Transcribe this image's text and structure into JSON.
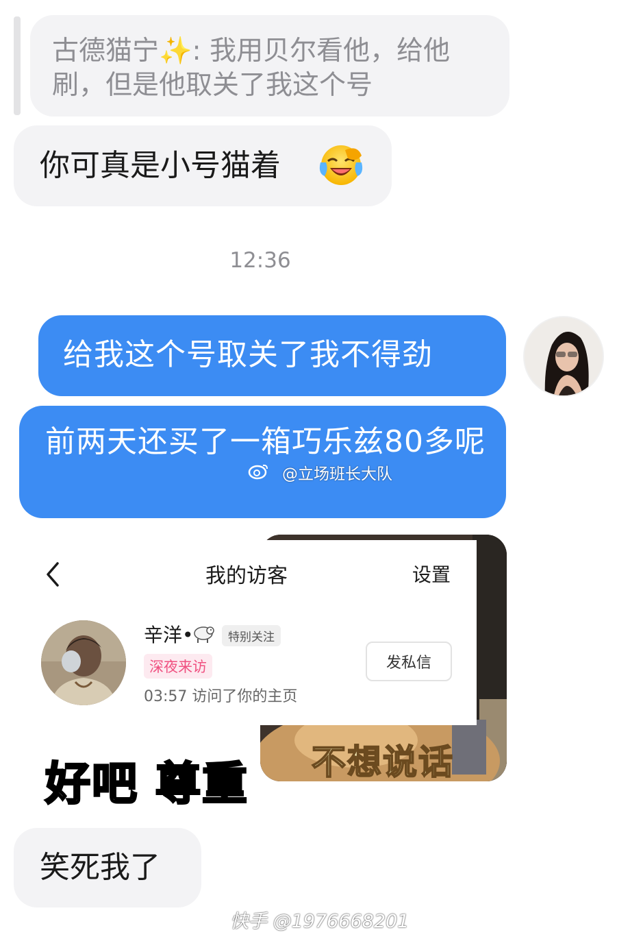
{
  "quoted_message": {
    "text": "古德猫宁✨: 我用贝尔看他，给他刷，但是他取关了我这个号"
  },
  "messages": [
    {
      "side": "left",
      "text": "你可真是小号猫着"
    },
    {
      "side": "right",
      "text": "给我这个号取关了我不得劲"
    },
    {
      "side": "right",
      "text": "前两天还买了一箱巧乐兹80多呢"
    },
    {
      "side": "left",
      "text": "笑死我了"
    }
  ],
  "timestamp": "12:36",
  "icons": {
    "laugh": "face-with-tears-of-joy-icon",
    "back": "chevron-left-icon",
    "sheep": "sheep-icon",
    "weibo": "weibo-logo-icon"
  },
  "screenshot_card": {
    "title": "我的访客",
    "settings": "设置",
    "visitor": {
      "name": "辛洋•",
      "follow_badge": "特别关注",
      "night_badge": "深夜来访",
      "visit_text": "03:57 访问了你的主页",
      "dm_button": "发私信"
    }
  },
  "meme_caption": "不想说话",
  "overlay_caption": "好吧 尊重",
  "watermarks": {
    "weibo": "@立场班长大队",
    "kuaishou": "快手 @1976668201"
  },
  "colors": {
    "bubble_left": "#f3f3f5",
    "bubble_right": "#3c8cf3",
    "timestamp": "#8e8e93",
    "night_badge": "#f05080"
  }
}
